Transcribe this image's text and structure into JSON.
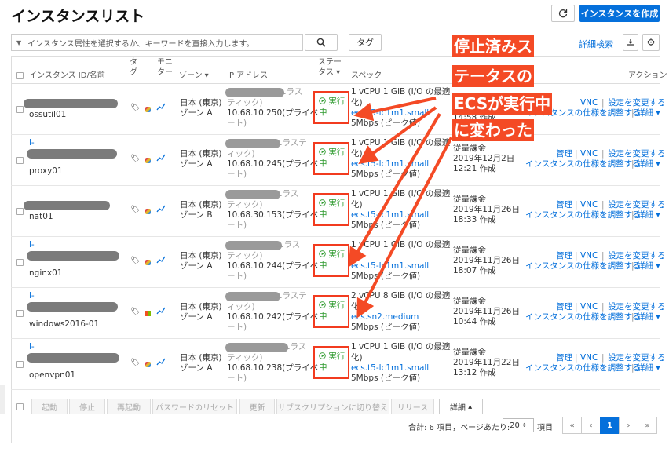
{
  "header": {
    "title": "インスタンスリスト",
    "create_label": "インスタンスを作成",
    "refresh_icon": "refresh-icon"
  },
  "toolbar": {
    "search_placeholder": "インスタンス属性を選択するか、キーワードを直接入力します。",
    "tag_label": "タグ",
    "detail_search_label": "詳細検索"
  },
  "columns": {
    "id_name": "インスタンス ID/名前",
    "tag": "タグ",
    "monitor": "モニター",
    "zone": "ゾーン",
    "ip": "IP アドレス",
    "status": "ステータス",
    "spec": "スペック",
    "action": "アクション"
  },
  "rows": [
    {
      "name": "ossutil01",
      "id_prefix": "",
      "zone_a": "日本 (東京)",
      "zone_b": "ゾーン A",
      "ip_top": "エラス",
      "ip_mid": "ティック)",
      "ip": "10.68.10.250(プライベ",
      "ip_end": "ート)",
      "status_a": "実行",
      "status_b": "中",
      "spec_a": "1 vCPU 1 GiB (I/O の最適",
      "spec_b": "化)",
      "spec_type": "ecs.t5-lc1m1.small",
      "spec_bw": "5Mbps (ピーク値)",
      "billing": "",
      "date": "",
      "time": "14:58 作成",
      "act_a": "VNC",
      "act_b": "設定を変更する",
      "act_c": "インスタンスの仕様を調整する",
      "act_d": "詳細"
    },
    {
      "name": "proxy01",
      "id_prefix": "i-",
      "zone_a": "日本 (東京)",
      "zone_b": "ゾーン A",
      "ip_top": "エラステ",
      "ip_mid": "ィック)",
      "ip": "10.68.10.245(プライベ",
      "ip_end": "ート)",
      "status_a": "実行",
      "status_b": "中",
      "spec_a": "1 vCPU 1 GiB (I/O の最適",
      "spec_b": "化)",
      "spec_type": "ecs.t5-lc1m1.small",
      "spec_bw": "5Mbps (ピーク値)",
      "billing": "従量課金",
      "date": "2019年12月2日",
      "time": "12:21 作成",
      "act_a": "管理",
      "act_vnc": "VNC",
      "act_b": "設定を変更する",
      "act_c": "インスタンスの仕様を調整する",
      "act_d": "詳細"
    },
    {
      "name": "nat01",
      "id_prefix": "",
      "zone_a": "日本 (東京)",
      "zone_b": "ゾーン B",
      "ip_top": "エラス",
      "ip_mid": "ティック)",
      "ip": "10.68.30.153(プライベ",
      "ip_end": "ート)",
      "status_a": "実行",
      "status_b": "中",
      "spec_a": "1 vCPU 1 GiB (I/O の最適",
      "spec_b": "化)",
      "spec_type": "ecs.t5-lc1m1.small",
      "spec_bw": "5Mbps (ピーク値)",
      "billing": "従量課金",
      "date": "2019年11月26日",
      "time": "18:33 作成",
      "act_a": "管理",
      "act_vnc": "VNC",
      "act_b": "設定を変更する",
      "act_c": "インスタンスの仕様を調整する",
      "act_d": "詳細"
    },
    {
      "name": "nginx01",
      "id_prefix": "i-",
      "zone_a": "日本 (東京)",
      "zone_b": "ゾーン A",
      "ip_top": "エラス",
      "ip_mid": "ティック)",
      "ip": "10.68.10.244(プライベ",
      "ip_end": "ート)",
      "status_a": "実行",
      "status_b": "中",
      "spec_a": "1 vCPU 1 GiB (I/O の最適",
      "spec_b": "化)",
      "spec_type": "ecs.t5-lc1m1.small",
      "spec_bw": "5Mbps (ピーク値)",
      "billing": "従量課金",
      "date": "2019年11月26日",
      "time": "18:07 作成",
      "act_a": "管理",
      "act_vnc": "VNC",
      "act_b": "設定を変更する",
      "act_c": "インスタンスの仕様を調整する",
      "act_d": "詳細"
    },
    {
      "name": "windows2016-01",
      "id_prefix": "i-",
      "zone_a": "日本 (東京)",
      "zone_b": "ゾーン A",
      "ip_top": "エラステ",
      "ip_mid": "ィック)",
      "ip": "10.68.10.242(プライベ",
      "ip_end": "ート)",
      "status_a": "実行",
      "status_b": "中",
      "spec_a": "2 vCPU 8 GiB (I/O の最適",
      "spec_b": "化)",
      "spec_type": "ecs.sn2.medium",
      "spec_bw": "5Mbps (ピーク値)",
      "billing": "従量課金",
      "date": "2019年11月26日",
      "time": "10:44 作成",
      "act_a": "管理",
      "act_vnc": "VNC",
      "act_b": "設定を変更する",
      "act_c": "インスタンスの仕様を調整する",
      "act_d": "詳細"
    },
    {
      "name": "openvpn01",
      "id_prefix": "i-",
      "zone_a": "日本 (東京)",
      "zone_b": "ゾーン A",
      "ip_top": "エラス",
      "ip_mid": "ティック)",
      "ip": "10.68.10.238(プライベ",
      "ip_end": "ート)",
      "status_a": "実行",
      "status_b": "中",
      "spec_a": "1 vCPU 1 GiB (I/O の最適",
      "spec_b": "化)",
      "spec_type": "ecs.t5-lc1m1.small",
      "spec_bw": "5Mbps (ピーク値)",
      "billing": "従量課金",
      "date": "2019年11月22日",
      "time": "13:12 作成",
      "act_a": "管理",
      "act_vnc": "VNC",
      "act_b": "設定を変更する",
      "act_c": "インスタンスの仕様を調整する",
      "act_d": "詳細"
    }
  ],
  "bulk_actions": [
    "起動",
    "停止",
    "再起動",
    "パスワードのリセット",
    "更新",
    "サブスクリプションに切り替え",
    "リリース"
  ],
  "more_label": "詳細",
  "pagination": {
    "summary": "合計: 6 項目，ページあたり:",
    "page_size": "20",
    "unit": "項目",
    "first": "«",
    "prev": "‹",
    "current": "1",
    "next": "›",
    "last": "»"
  },
  "annotation": {
    "line1": "停止済みス",
    "line2": "テータスの",
    "line3": "ECSが実行中",
    "line4": "に変わった",
    "color": "#f44a25"
  }
}
